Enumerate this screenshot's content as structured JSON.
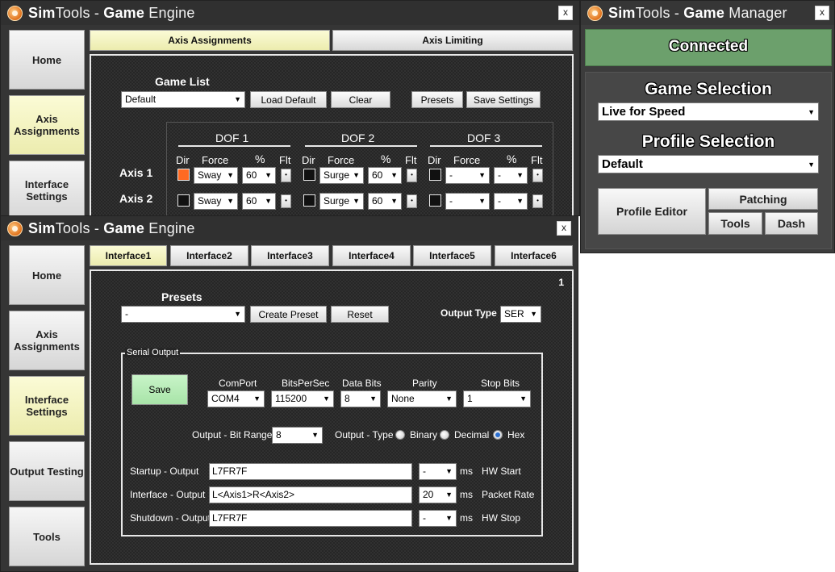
{
  "engine_top": {
    "title_bold": "Sim",
    "title_light": "Tools - ",
    "title_bold2": "Game",
    "title_light2": " Engine",
    "close": "x",
    "sidebar": [
      "Home",
      "Axis Assignments",
      "Interface Settings"
    ],
    "tabs": [
      "Axis Assignments",
      "Axis Limiting"
    ],
    "game_list_label": "Game List",
    "game_list_value": "Default",
    "buttons": {
      "load_default": "Load Default",
      "clear": "Clear",
      "presets": "Presets",
      "save_settings": "Save Settings"
    },
    "dof_headers": [
      "DOF 1",
      "DOF 2",
      "DOF 3"
    ],
    "col_dir": "Dir",
    "col_force": "Force",
    "col_pct": "%",
    "col_flt": "Flt",
    "axes": [
      {
        "label": "Axis 1",
        "dof": [
          {
            "dir_on": true,
            "force": "Sway",
            "pct": "60"
          },
          {
            "dir_on": false,
            "force": "Surge",
            "pct": "60"
          },
          {
            "dir_on": false,
            "force": "-",
            "pct": "-"
          }
        ]
      },
      {
        "label": "Axis 2",
        "dof": [
          {
            "dir_on": false,
            "force": "Sway",
            "pct": "60"
          },
          {
            "dir_on": false,
            "force": "Surge",
            "pct": "60"
          },
          {
            "dir_on": false,
            "force": "-",
            "pct": "-"
          }
        ]
      }
    ],
    "flt_btn": "•"
  },
  "manager": {
    "title_bold": "Sim",
    "title_light": "Tools - ",
    "title_bold2": "Game",
    "title_light2": " Manager",
    "close": "x",
    "status": "Connected",
    "game_selection_label": "Game Selection",
    "game_selection_value": "Live for Speed",
    "profile_selection_label": "Profile Selection",
    "profile_selection_value": "Default",
    "buttons": {
      "profile_editor": "Profile Editor",
      "patching": "Patching",
      "tools": "Tools",
      "dash": "Dash"
    }
  },
  "engine_bottom": {
    "title_bold": "Sim",
    "title_light": "Tools - ",
    "title_bold2": "Game",
    "title_light2": " Engine",
    "close": "x",
    "sidebar": [
      "Home",
      "Axis Assignments",
      "Interface Settings",
      "Output Testing",
      "Tools"
    ],
    "tabs": [
      "Interface1",
      "Interface2",
      "Interface3",
      "Interface4",
      "Interface5",
      "Interface6"
    ],
    "corner_number": "1",
    "presets_label": "Presets",
    "presets_value": "-",
    "buttons": {
      "create_preset": "Create Preset",
      "reset": "Reset",
      "save": "Save"
    },
    "output_type_label": "Output Type",
    "output_type_value": "SER",
    "serial_group": "Serial Output",
    "fields": {
      "comport_label": "ComPort",
      "comport_value": "COM4",
      "bps_label": "BitsPerSec",
      "bps_value": "115200",
      "databits_label": "Data Bits",
      "databits_value": "8",
      "parity_label": "Parity",
      "parity_value": "None",
      "stopbits_label": "Stop Bits",
      "stopbits_value": "1"
    },
    "bit_range_label": "Output - Bit Range",
    "bit_range_value": "8",
    "output_type2_label": "Output - Type",
    "radio": {
      "binary": "Binary",
      "decimal": "Decimal",
      "hex": "Hex",
      "selected": "Hex"
    },
    "rows": [
      {
        "label": "Startup - Output",
        "value": "L7FR7F",
        "ms_value": "-",
        "ms": "ms",
        "suffix": "HW Start"
      },
      {
        "label": "Interface - Output",
        "value": "L<Axis1>R<Axis2>",
        "ms_value": "20",
        "ms": "ms",
        "suffix": "Packet Rate"
      },
      {
        "label": "Shutdown - Output",
        "value": "L7FR7F",
        "ms_value": "-",
        "ms": "ms",
        "suffix": "HW Stop"
      }
    ]
  }
}
